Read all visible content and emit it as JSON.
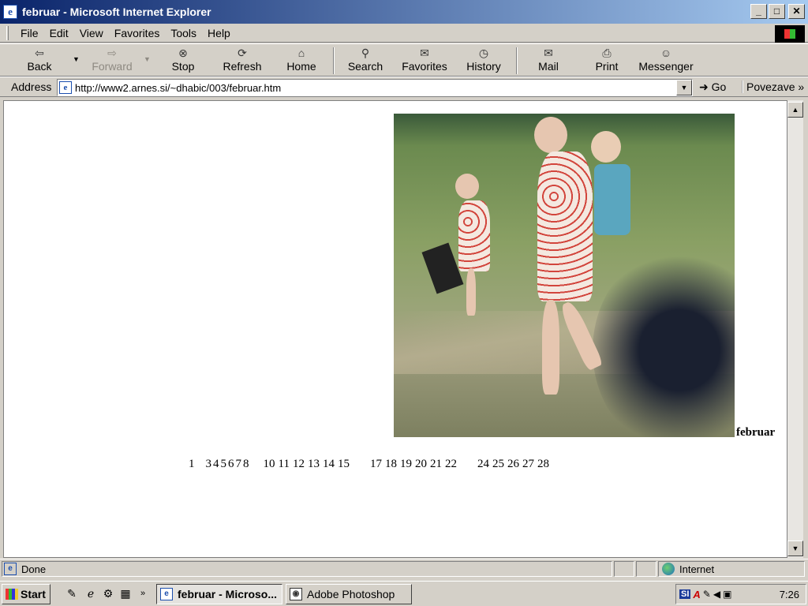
{
  "window": {
    "title": "februar - Microsoft Internet Explorer",
    "minimize": "_",
    "maximize": "□",
    "close": "✕"
  },
  "menu": [
    "File",
    "Edit",
    "View",
    "Favorites",
    "Tools",
    "Help"
  ],
  "toolbar": {
    "back": "Back",
    "forward": "Forward",
    "stop": "Stop",
    "refresh": "Refresh",
    "home": "Home",
    "search": "Search",
    "favorites": "Favorites",
    "history": "History",
    "mail": "Mail",
    "print": "Print",
    "messenger": "Messenger"
  },
  "icons": {
    "back": "⇦",
    "forward": "⇨",
    "stop": "⊗",
    "refresh": "⟳",
    "home": "⌂",
    "search": "⚲",
    "favorites": "✉",
    "history": "◷",
    "mail": "✉",
    "print": "⎙",
    "messenger": "☺"
  },
  "address": {
    "label": "Address",
    "url": "http://www2.arnes.si/~dhabic/003/februar.htm",
    "go": "Go",
    "links": "Povezave"
  },
  "page": {
    "caption": "februar",
    "days": [
      "1",
      "3",
      "4",
      "5",
      "6",
      "7",
      "8",
      "10",
      "11",
      "12",
      "13",
      "14",
      "15",
      "17",
      "18",
      "19",
      "20",
      "21",
      "22",
      "24",
      "25",
      "26",
      "27",
      "28"
    ]
  },
  "status": {
    "text": "Done",
    "zone": "Internet"
  },
  "taskbar": {
    "start": "Start",
    "tasks": [
      "februar - Microso...",
      "Adobe Photoshop"
    ],
    "tray_si": "SI",
    "clock": "7:26"
  }
}
